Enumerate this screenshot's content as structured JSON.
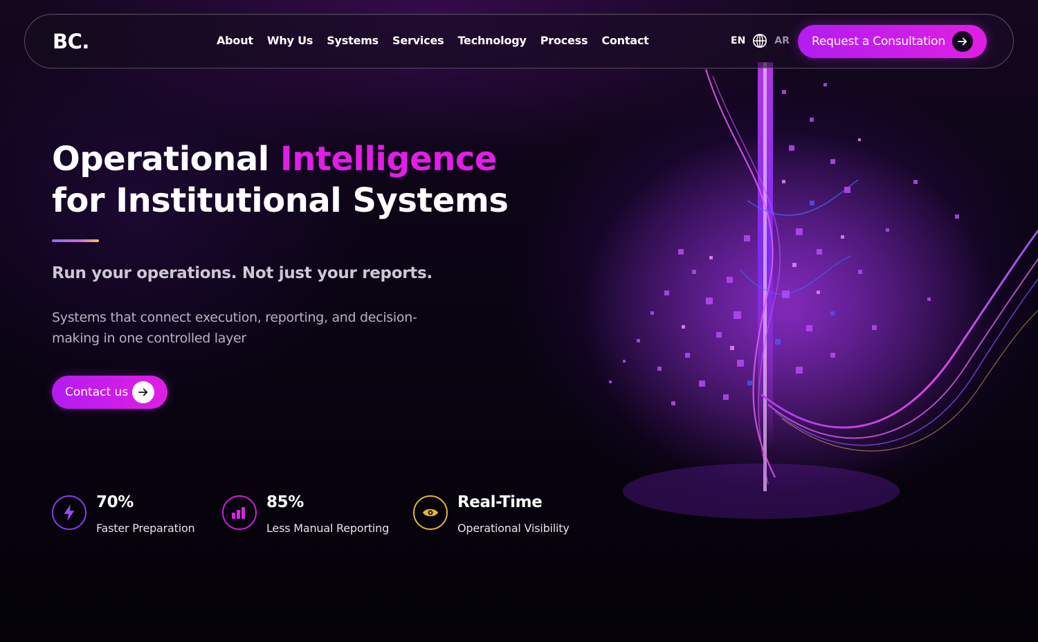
{
  "nav": {
    "logo": "BC.",
    "menu": [
      "About",
      "Why Us",
      "Systems",
      "Services",
      "Technology",
      "Process",
      "Contact"
    ],
    "lang_en": "EN",
    "lang_ar": "AR",
    "cta_label": "Request a Consultation"
  },
  "hero": {
    "headline_part1": "Operational ",
    "headline_accent": "Intelligence",
    "headline_line2": "for Institutional Systems",
    "tagline": "Run your operations. Not just your reports.",
    "description": "Systems that connect execution, reporting, and decision-making in one controlled layer",
    "contact_label": "Contact us"
  },
  "stats": [
    {
      "value": "70%",
      "caption": "Faster Preparation",
      "icon": "lightning-icon",
      "color": "#8a3cf0"
    },
    {
      "value": "85%",
      "caption": "Less Manual Reporting",
      "icon": "bar-chart-icon",
      "color": "#d11ee0"
    },
    {
      "value": "Real-Time",
      "caption": "Operational Visibility",
      "icon": "eye-icon",
      "color": "#e8b43a"
    }
  ],
  "colors": {
    "accent": "#e21ee6",
    "button_start": "#b31cf0",
    "button_end": "#e11ee3",
    "background": "#05030b"
  }
}
